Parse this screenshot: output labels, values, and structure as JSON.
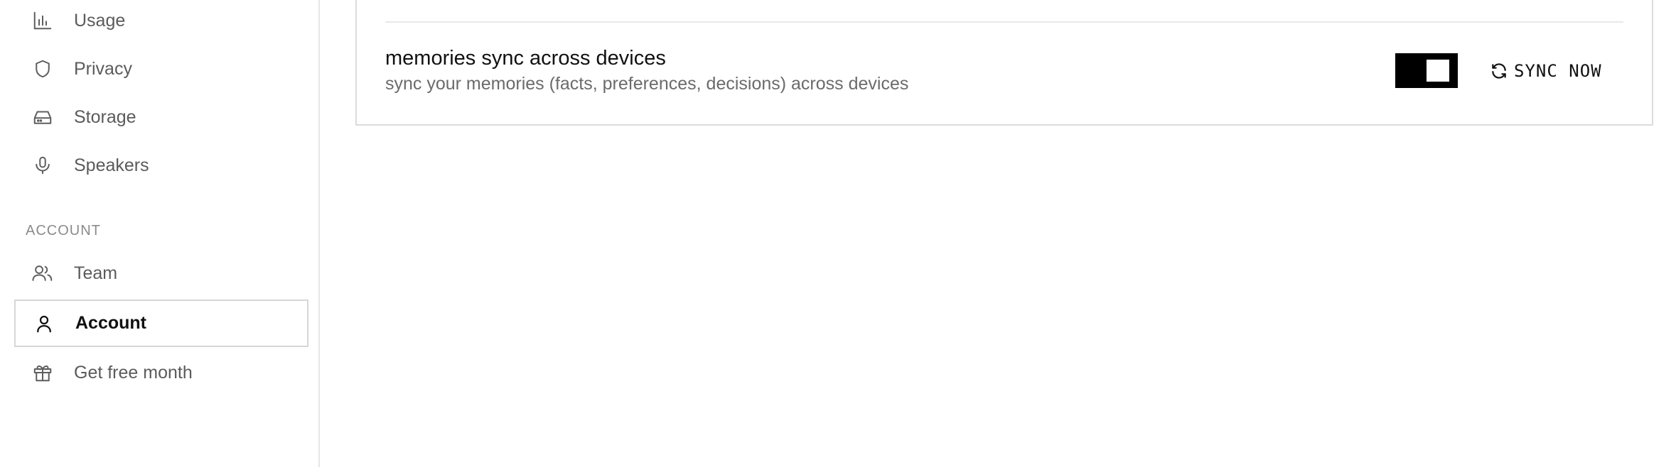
{
  "sidebar": {
    "items": [
      {
        "label": "Usage",
        "icon": "bar-chart-icon"
      },
      {
        "label": "Privacy",
        "icon": "shield-icon"
      },
      {
        "label": "Storage",
        "icon": "hard-drive-icon"
      },
      {
        "label": "Speakers",
        "icon": "microphone-icon"
      }
    ],
    "section_label": "ACCOUNT",
    "account_items": [
      {
        "label": "Team",
        "icon": "users-icon"
      },
      {
        "label": "Account",
        "icon": "user-icon",
        "active": true
      },
      {
        "label": "Get free month",
        "icon": "gift-icon"
      }
    ]
  },
  "main": {
    "setting": {
      "title": "memories sync across devices",
      "description": "sync your memories (facts, preferences, decisions) across devices",
      "toggle_on": true
    },
    "sync_button": {
      "label": "SYNC NOW",
      "icon": "refresh-icon"
    }
  },
  "colors": {
    "toggle_bg": "#000000",
    "active_border": "#d6d6d6",
    "muted_text": "#6b6b6b"
  }
}
